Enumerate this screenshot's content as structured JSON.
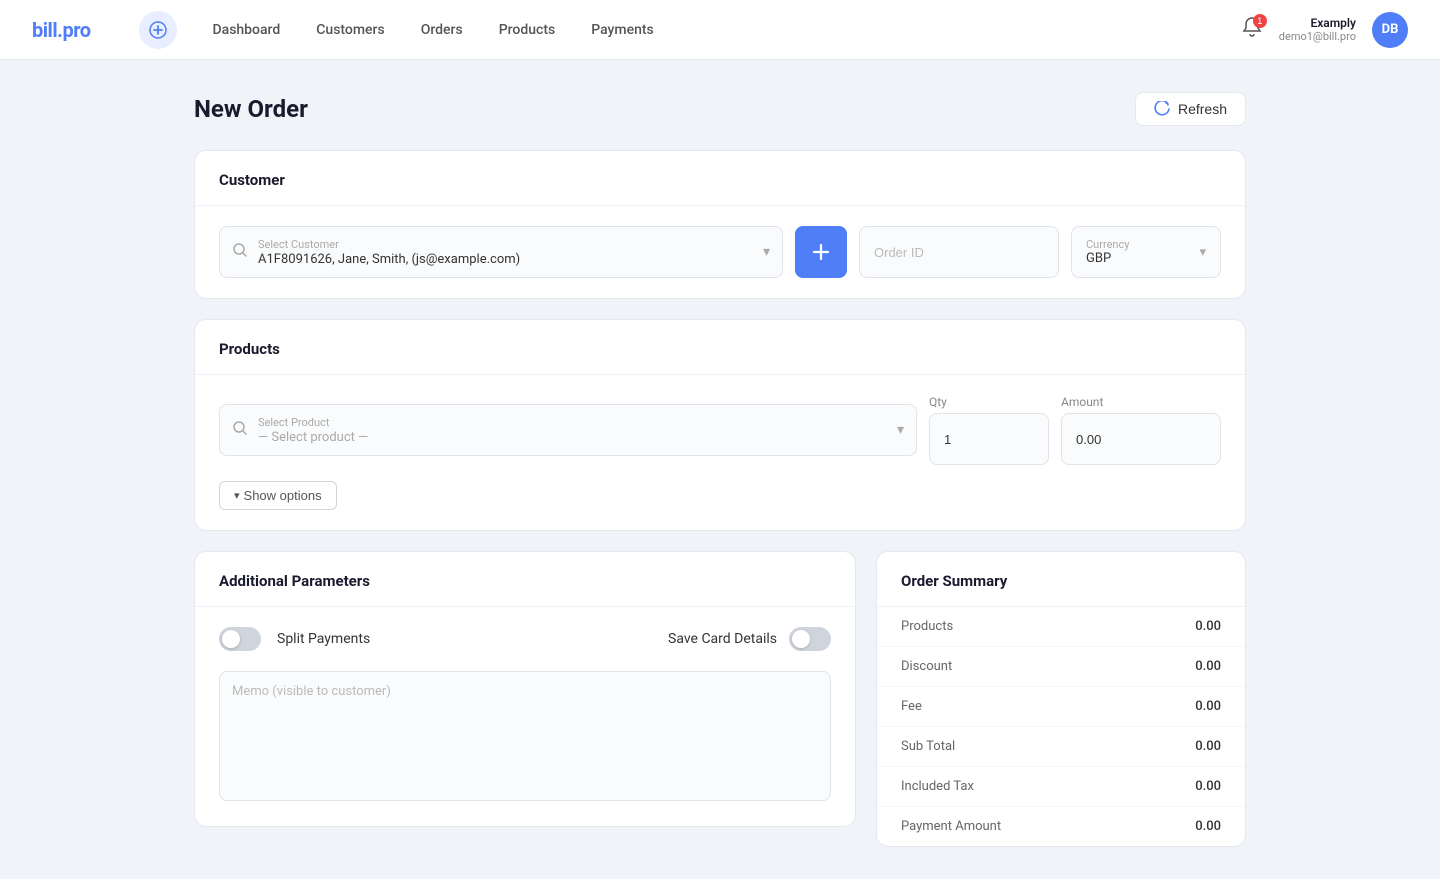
{
  "logo": {
    "text1": "bill",
    "text2": ".pro"
  },
  "nav": {
    "add_btn_title": "Add",
    "links": [
      "Dashboard",
      "Customers",
      "Orders",
      "Products",
      "Payments"
    ]
  },
  "user": {
    "name": "Examply",
    "email": "demo1@bill.pro",
    "initials": "DB"
  },
  "page": {
    "title": "New Order",
    "refresh_label": "Refresh"
  },
  "customer_section": {
    "title": "Customer",
    "select_label": "Select Customer",
    "select_value": "A1F8091626, Jane, Smith, (js@example.com)",
    "order_id_placeholder": "Order ID",
    "currency_label": "Currency",
    "currency_value": "GBP"
  },
  "products_section": {
    "title": "Products",
    "select_label": "Select Product",
    "select_placeholder": "— Select product —",
    "qty_label": "Qty",
    "qty_value": "1",
    "amount_label": "Amount",
    "amount_value": "0.00",
    "show_options_label": "Show options"
  },
  "additional_params": {
    "title": "Additional Parameters",
    "split_payments_label": "Split Payments",
    "split_payments_active": false,
    "save_card_label": "Save Card Details",
    "save_card_active": false,
    "memo_placeholder": "Memo (visible to customer)"
  },
  "order_summary": {
    "title": "Order Summary",
    "rows": [
      {
        "label": "Products",
        "value": "0.00"
      },
      {
        "label": "Discount",
        "value": "0.00"
      },
      {
        "label": "Fee",
        "value": "0.00"
      },
      {
        "label": "Sub Total",
        "value": "0.00"
      },
      {
        "label": "Included Tax",
        "value": "0.00"
      },
      {
        "label": "Payment Amount",
        "value": "0.00"
      }
    ]
  }
}
